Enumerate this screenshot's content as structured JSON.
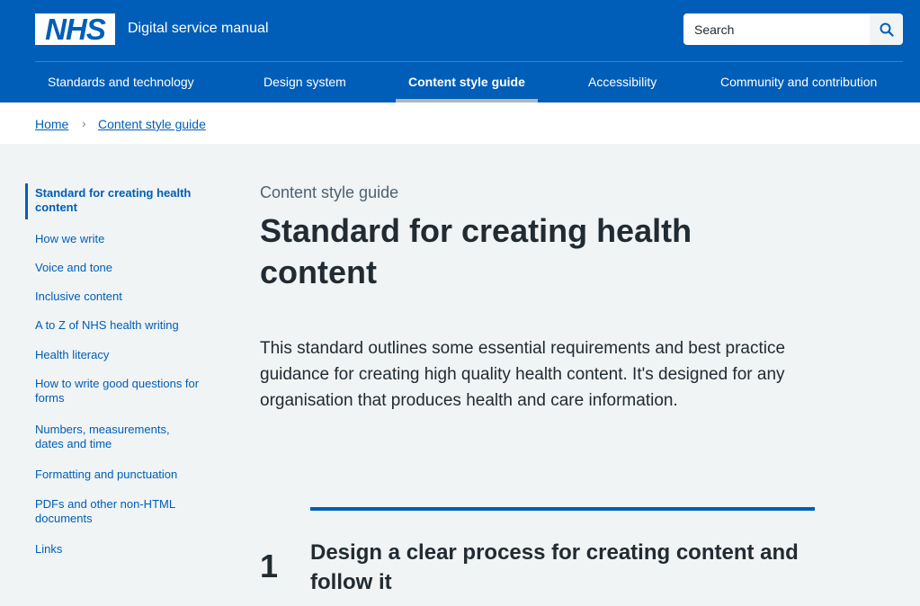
{
  "header": {
    "logo_text": "NHS",
    "service_name": "Digital service manual",
    "search_placeholder": "Search"
  },
  "nav": {
    "items": [
      {
        "label": "Standards and technology"
      },
      {
        "label": "Design system"
      },
      {
        "label": "Content style guide",
        "active": true
      },
      {
        "label": "Accessibility"
      },
      {
        "label": "Community and contribution"
      }
    ]
  },
  "breadcrumb": {
    "items": [
      {
        "label": "Home"
      },
      {
        "label": "Content style guide"
      }
    ],
    "separator": "›"
  },
  "sidebar": {
    "items": [
      {
        "label": "Standard for creating health content",
        "active": true
      },
      {
        "label": "How we write"
      },
      {
        "label": "Voice and tone"
      },
      {
        "label": "Inclusive content"
      },
      {
        "label": "A to Z of NHS health writing"
      },
      {
        "label": "Health literacy"
      },
      {
        "label": "How to write good questions for forms"
      },
      {
        "label": "Numbers, measurements, dates and time"
      },
      {
        "label": "Formatting and punctuation"
      },
      {
        "label": "PDFs and other non-HTML documents"
      },
      {
        "label": "Links"
      }
    ]
  },
  "main": {
    "caption": "Content style guide",
    "title": "Standard for creating health content",
    "lede": "This standard outlines some essential requirements and best practice guidance for creating high quality health content. It's designed for any organisation that produces health and care information.",
    "section": {
      "number": "1",
      "title": "Design a clear process for creating content and follow it"
    }
  },
  "colors": {
    "nhs_blue": "#005eb8",
    "text": "#212b32",
    "secondary_text": "#4c6272",
    "page_background": "#f0f4f5",
    "white": "#ffffff"
  },
  "icons": {
    "search_button": "search-icon"
  }
}
